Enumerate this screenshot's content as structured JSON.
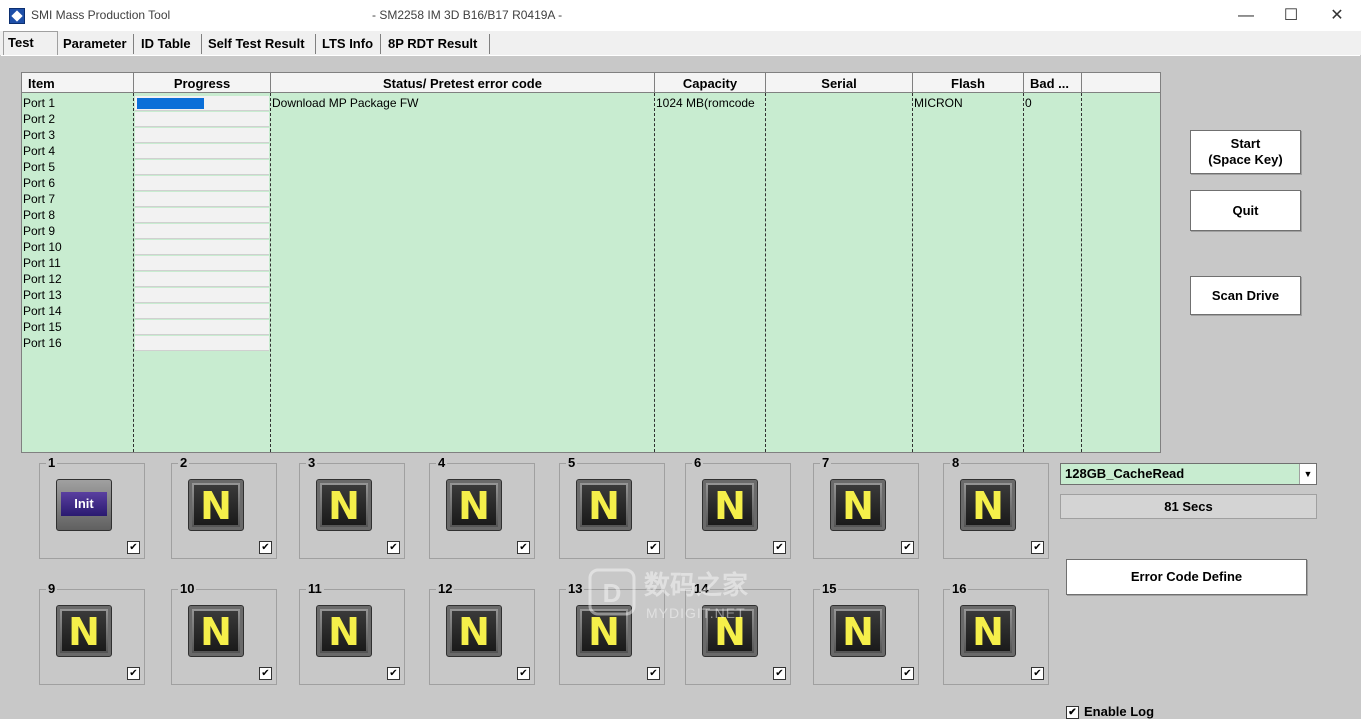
{
  "window": {
    "app_name": "SMI Mass Production Tool",
    "title": "- SM2258 IM 3D B16/B17 R0419A -",
    "minimize": "—",
    "maximize": "☐",
    "close": "✕"
  },
  "tabs": [
    "Test",
    "Parameter",
    "ID Table",
    "Self Test Result",
    "LTS Info",
    "8P RDT Result"
  ],
  "grid": {
    "headers": [
      "Item",
      "Progress",
      "Status/ Pretest error code",
      "Capacity",
      "Serial",
      "Flash",
      "Bad ..."
    ],
    "rows": [
      {
        "item": "Port 1",
        "progress": 0.5,
        "status": "Download MP Package FW",
        "capacity": "1024 MB(romcode",
        "serial": "",
        "flash": "MICRON",
        "bad": "0"
      },
      {
        "item": "Port 2",
        "progress": 0
      },
      {
        "item": "Port 3",
        "progress": 0
      },
      {
        "item": "Port 4",
        "progress": 0
      },
      {
        "item": "Port 5",
        "progress": 0
      },
      {
        "item": "Port 6",
        "progress": 0
      },
      {
        "item": "Port 7",
        "progress": 0
      },
      {
        "item": "Port 8",
        "progress": 0
      },
      {
        "item": "Port 9",
        "progress": 0
      },
      {
        "item": "Port 10",
        "progress": 0
      },
      {
        "item": "Port 11",
        "progress": 0
      },
      {
        "item": "Port 12",
        "progress": 0
      },
      {
        "item": "Port 13",
        "progress": 0
      },
      {
        "item": "Port 14",
        "progress": 0
      },
      {
        "item": "Port 15",
        "progress": 0
      },
      {
        "item": "Port 16",
        "progress": 0
      }
    ]
  },
  "buttons": {
    "start": "Start\n(Space Key)",
    "quit": "Quit",
    "scan": "Scan Drive",
    "error_code": "Error Code Define"
  },
  "ports": [
    {
      "num": "1",
      "state": "Init",
      "checked": true
    },
    {
      "num": "2",
      "state": "N",
      "checked": true
    },
    {
      "num": "3",
      "state": "N",
      "checked": true
    },
    {
      "num": "4",
      "state": "N",
      "checked": true
    },
    {
      "num": "5",
      "state": "N",
      "checked": true
    },
    {
      "num": "6",
      "state": "N",
      "checked": true
    },
    {
      "num": "7",
      "state": "N",
      "checked": true
    },
    {
      "num": "8",
      "state": "N",
      "checked": true
    },
    {
      "num": "9",
      "state": "N",
      "checked": true
    },
    {
      "num": "10",
      "state": "N",
      "checked": true
    },
    {
      "num": "11",
      "state": "N",
      "checked": true
    },
    {
      "num": "12",
      "state": "N",
      "checked": true
    },
    {
      "num": "13",
      "state": "N",
      "checked": true
    },
    {
      "num": "14",
      "state": "N",
      "checked": true
    },
    {
      "num": "15",
      "state": "N",
      "checked": true
    },
    {
      "num": "16",
      "state": "N",
      "checked": true
    }
  ],
  "test_mode": {
    "selected": "128GB_CacheRead"
  },
  "timer": "81 Secs",
  "enable_log": {
    "label": "Enable Log",
    "checked": true
  },
  "watermark": {
    "text": "数码之家",
    "sub": "MYDIGIT.NET"
  },
  "colors": {
    "grid_bg": "#c8ecd0",
    "progress_fill": "#0a6fd8",
    "n_text": "#f5ef4a",
    "init_bg": "#3a2a88"
  }
}
